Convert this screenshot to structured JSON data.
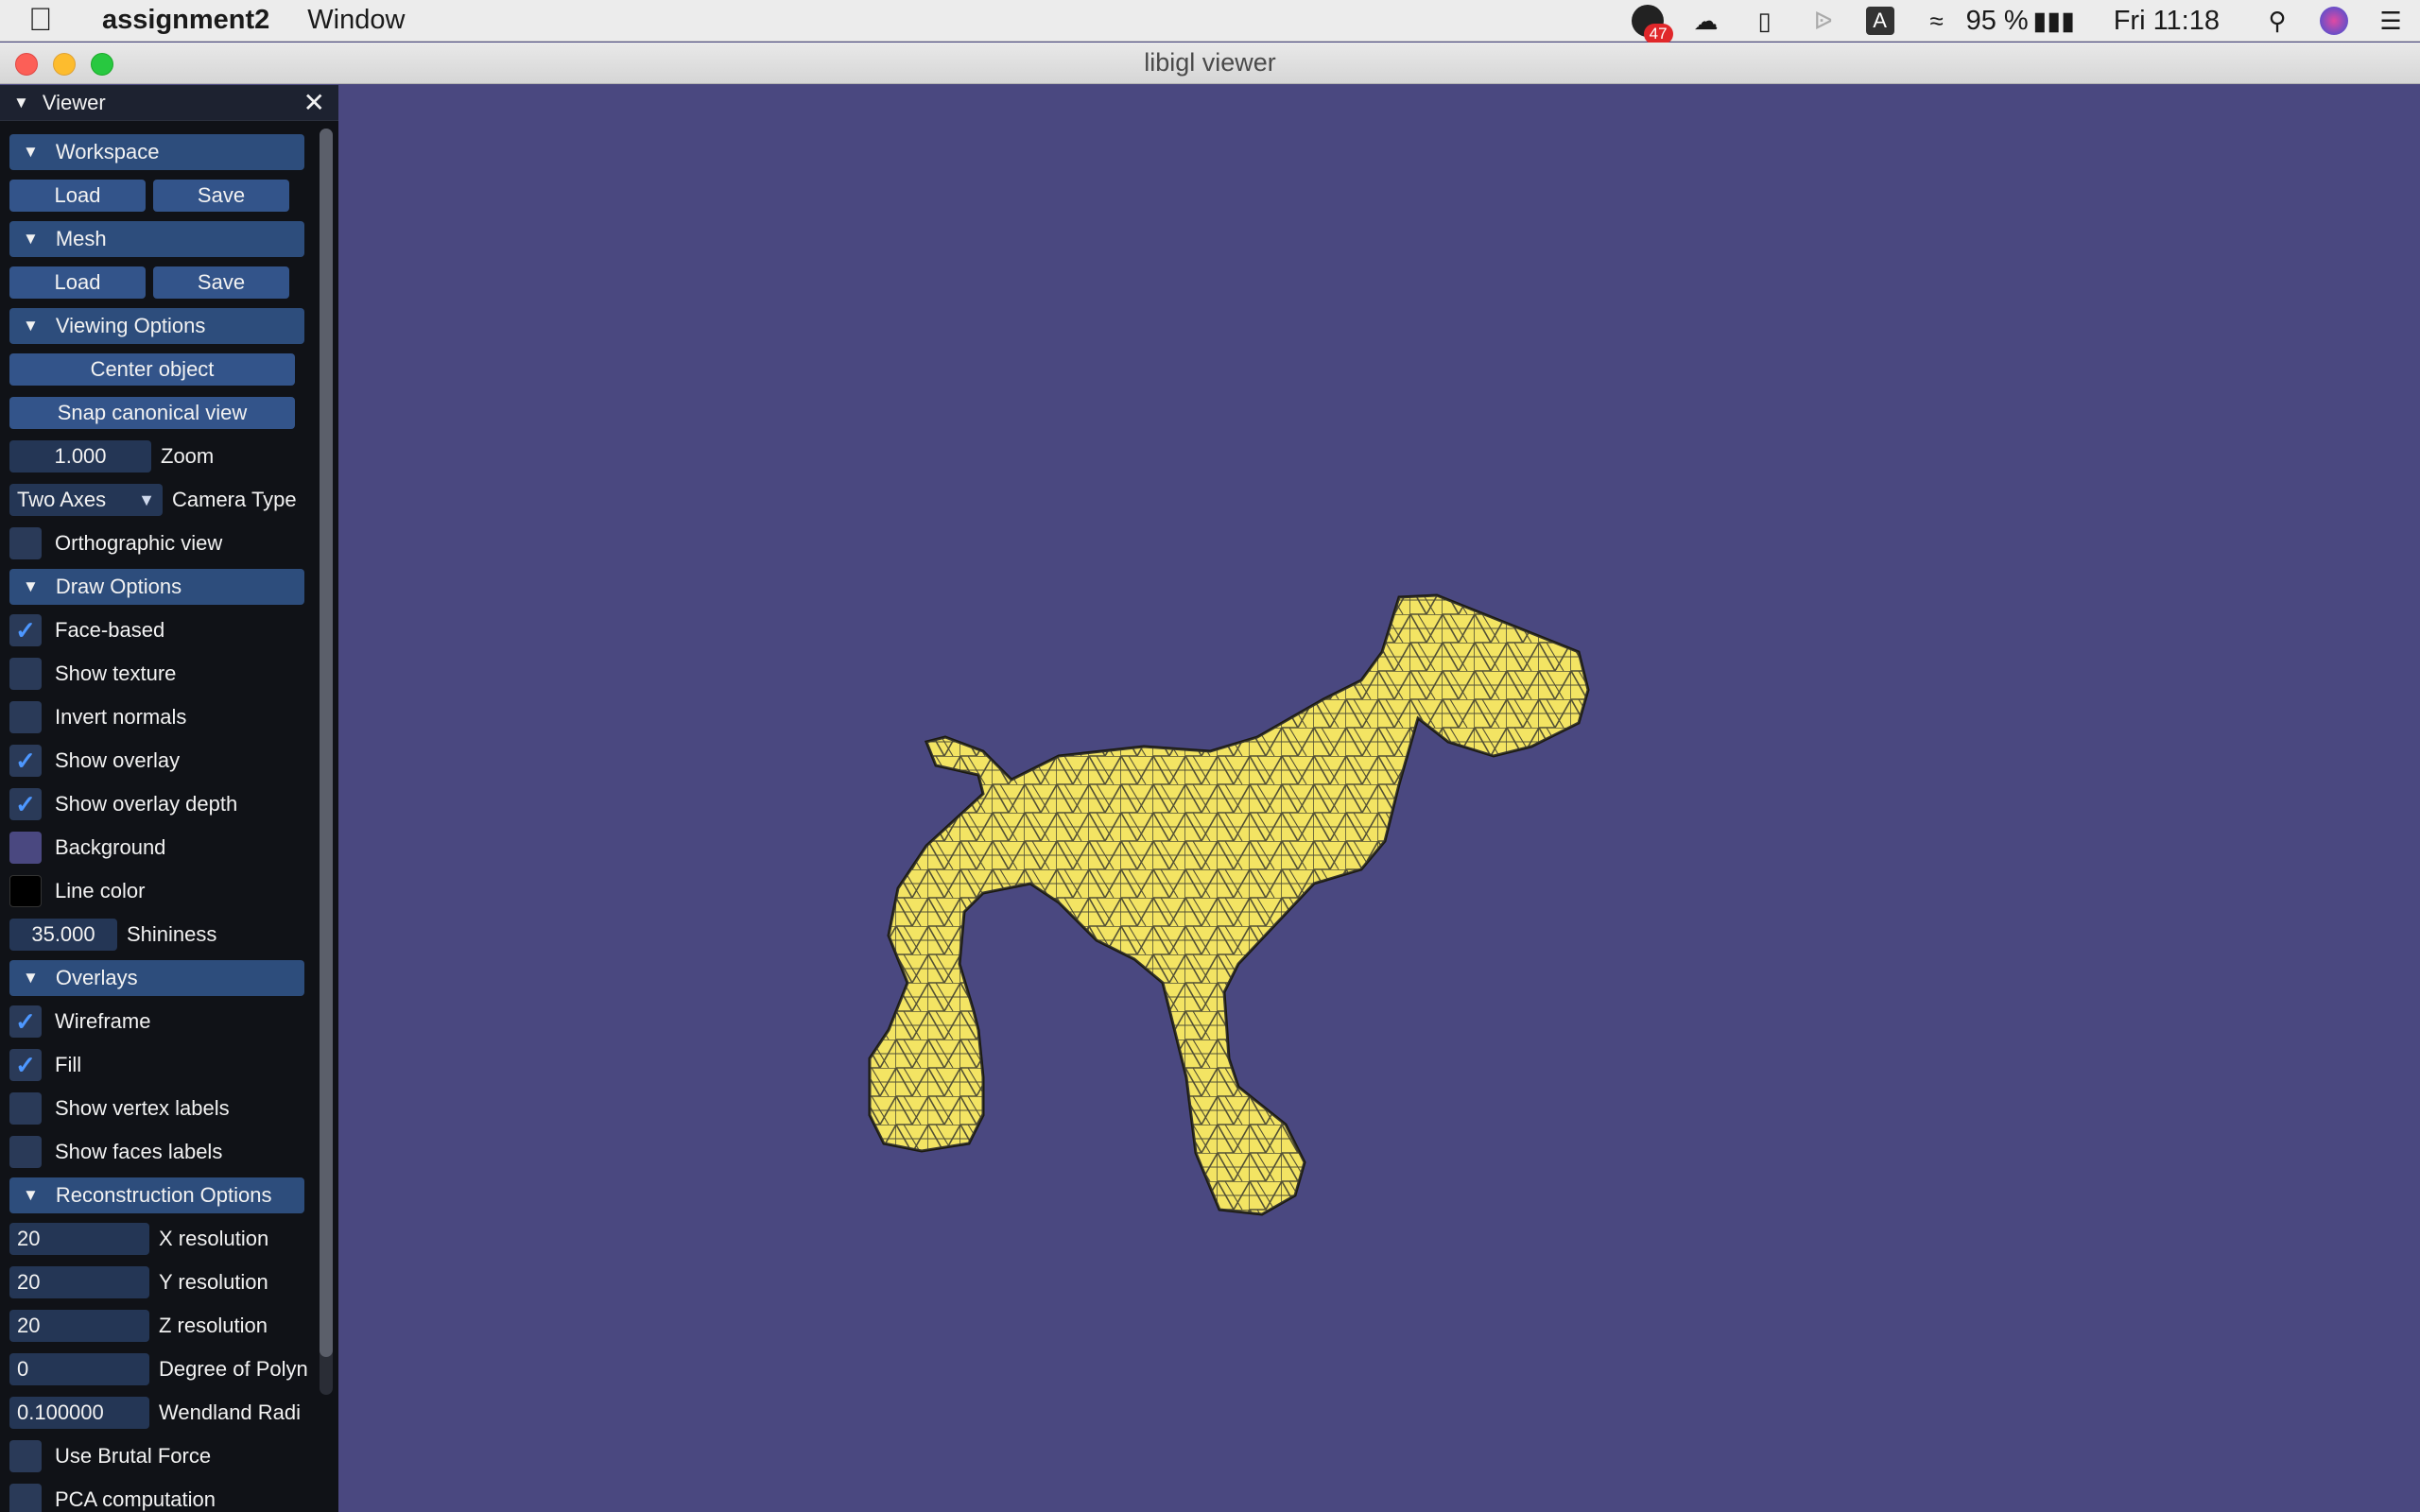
{
  "menubar": {
    "app_name": "assignment2",
    "menus": [
      "Window"
    ],
    "notification_count": "47",
    "battery": "95 %",
    "clock": "Fri 11:18"
  },
  "window": {
    "title": "libigl viewer"
  },
  "panel": {
    "title": "Viewer",
    "workspace": {
      "header": "Workspace",
      "load": "Load",
      "save": "Save"
    },
    "mesh": {
      "header": "Mesh",
      "load": "Load",
      "save": "Save"
    },
    "viewing": {
      "header": "Viewing Options",
      "center_object": "Center object",
      "snap_view": "Snap canonical view",
      "zoom_value": "1.000",
      "zoom_label": "Zoom",
      "camera_value": "Two Axes",
      "camera_label": "Camera Type",
      "orthographic": "Orthographic view"
    },
    "draw": {
      "header": "Draw Options",
      "face_based": "Face-based",
      "show_texture": "Show texture",
      "invert_normals": "Invert normals",
      "show_overlay": "Show overlay",
      "show_overlay_depth": "Show overlay depth",
      "background": "Background",
      "line_color": "Line color",
      "shininess_value": "35.000",
      "shininess_label": "Shininess",
      "background_color": "#4a4880",
      "line_color_value": "#000000"
    },
    "overlays": {
      "header": "Overlays",
      "wireframe": "Wireframe",
      "fill": "Fill",
      "vertex_labels": "Show vertex labels",
      "faces_labels": "Show faces labels"
    },
    "reconstruction": {
      "header": "Reconstruction Options",
      "x_res_value": "20",
      "x_res_label": "X resolution",
      "y_res_value": "20",
      "y_res_label": "Y resolution",
      "z_res_value": "20",
      "z_res_label": "Z resolution",
      "degree_value": "0",
      "degree_label": "Degree of Polyn",
      "wendland_value": "0.100000",
      "wendland_label": "Wendland Radi",
      "brute_force": "Use Brutal Force",
      "pca": "PCA computation"
    }
  },
  "colors": {
    "mesh_fill": "#f2e14e",
    "accent": "#2d4d7c",
    "viewport_bg": "#4a4880"
  }
}
